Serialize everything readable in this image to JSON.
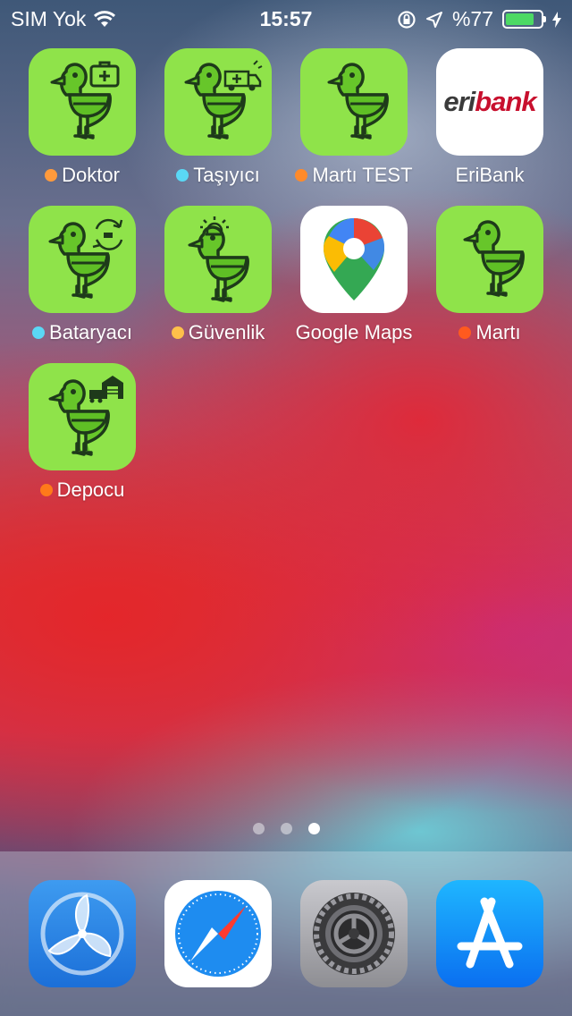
{
  "status_bar": {
    "carrier": "SIM Yok",
    "time": "15:57",
    "battery_percent": "%77",
    "battery_level": 0.77
  },
  "apps": [
    {
      "label": "Doktor",
      "badge_color": "#ff9a3c",
      "icon": "bird-medical-icon"
    },
    {
      "label": "Taşıyıcı",
      "badge_color": "#5ad8f5",
      "icon": "bird-ambulance-icon"
    },
    {
      "label": "Martı TEST",
      "badge_color": "#ff8a2a",
      "icon": "bird-icon"
    },
    {
      "label": "EriBank",
      "badge_color": "",
      "icon": "eribank-logo-icon",
      "logo_text": "eribank"
    },
    {
      "label": "Bataryacı",
      "badge_color": "#5ad8f5",
      "icon": "bird-battery-swap-icon"
    },
    {
      "label": "Güvenlik",
      "badge_color": "#ffc04a",
      "icon": "bird-alarm-icon"
    },
    {
      "label": "Google Maps",
      "badge_color": "",
      "icon": "google-maps-pin-icon"
    },
    {
      "label": "Martı",
      "badge_color": "#ff5a1f",
      "icon": "bird-icon"
    },
    {
      "label": "Depocu",
      "badge_color": "#ff7a1a",
      "icon": "bird-warehouse-icon"
    }
  ],
  "page_indicator": {
    "pages": 3,
    "current": 3
  },
  "dock": [
    {
      "name": "propeller-app",
      "icon": "propeller-icon"
    },
    {
      "name": "safari",
      "icon": "compass-icon"
    },
    {
      "name": "settings",
      "icon": "gear-icon"
    },
    {
      "name": "app-store",
      "icon": "app-store-icon"
    }
  ]
}
